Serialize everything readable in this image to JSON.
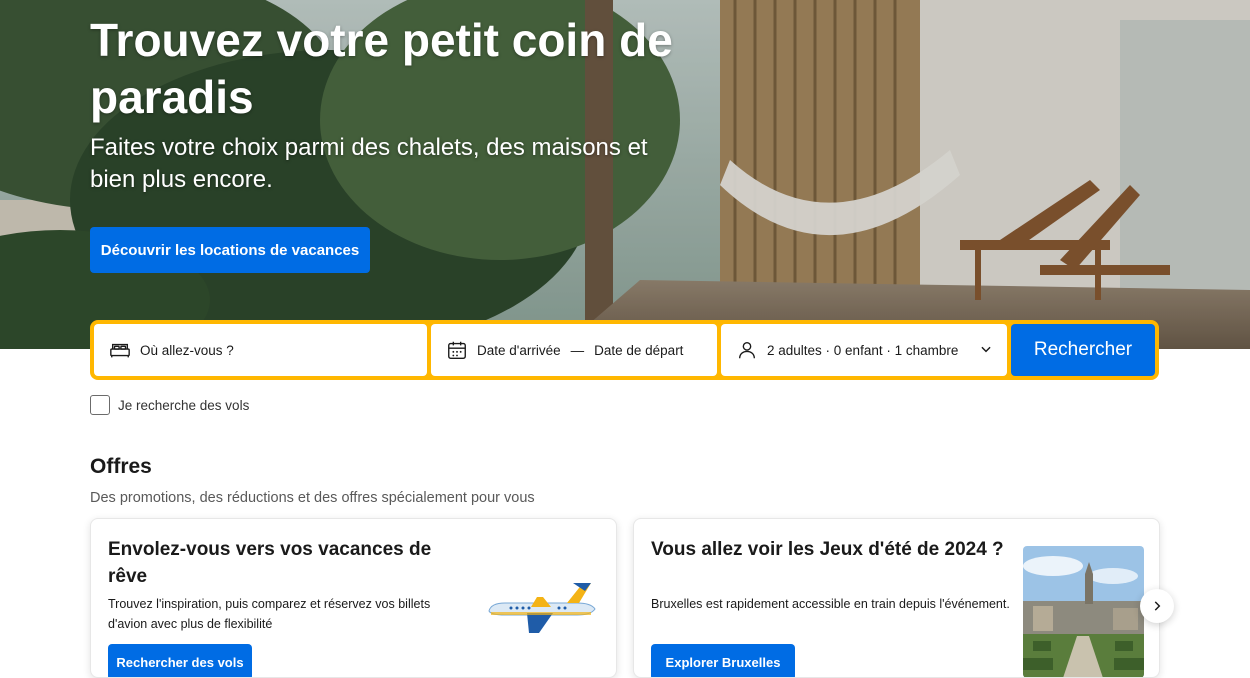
{
  "hero": {
    "title": "Trouvez votre petit coin de paradis",
    "subtitle": "Faites votre choix parmi des chalets, des maisons et bien plus encore.",
    "cta_label": "Découvrir les locations de vacances"
  },
  "search": {
    "destination_placeholder": "Où allez-vous ?",
    "checkin_label": "Date d'arrivée",
    "separator": "—",
    "checkout_label": "Date de départ",
    "occupancy_label": "2 adultes · 0 enfant · 1 chambre",
    "submit_label": "Rechercher",
    "flights_checkbox_label": "Je recherche des vols",
    "flights_checked": false
  },
  "offers": {
    "title": "Offres",
    "subtitle": "Des promotions, des réductions et des offres spécialement pour vous",
    "cards": [
      {
        "title": "Envolez-vous vers vos vacances de rêve",
        "text": "Trouvez l'inspiration, puis comparez et réservez vos billets d'avion avec plus de flexibilité",
        "button_label": "Rechercher des vols"
      },
      {
        "title": "Vous allez voir les Jeux d'été de 2024 ?",
        "text": "Bruxelles est rapidement accessible en train depuis l'événement.",
        "button_label": "Explorer Bruxelles"
      }
    ]
  },
  "colors": {
    "brand_blue": "#006ce4",
    "search_border": "#ffb700"
  },
  "icons": {
    "destination": "bed-icon",
    "dates": "calendar-icon",
    "occupancy": "person-icon",
    "dropdown": "chevron-down-icon",
    "carousel_next": "chevron-right-icon"
  }
}
